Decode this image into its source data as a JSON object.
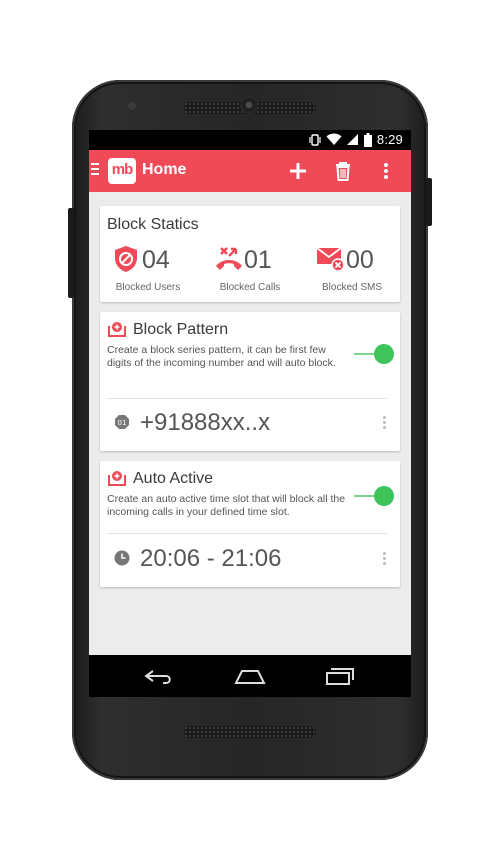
{
  "status_bar": {
    "time": "8:29",
    "icons": [
      "vibrate-icon",
      "wifi-icon",
      "signal-icon",
      "battery-icon"
    ]
  },
  "app_bar": {
    "logo_text": "mb",
    "title": "Home",
    "actions": [
      "add-icon",
      "trash-icon",
      "overflow-menu-icon"
    ]
  },
  "colors": {
    "accent": "#f04a58",
    "toggle_on": "#3ec45a",
    "background": "#ececec"
  },
  "block_statics": {
    "title": "Block Statics",
    "stats": [
      {
        "icon": "blocked-user-shield-icon",
        "count": "04",
        "label": "Blocked Users"
      },
      {
        "icon": "blocked-call-icon",
        "count": "01",
        "label": "Blocked Calls"
      },
      {
        "icon": "blocked-sms-icon",
        "count": "00",
        "label": "Blocked SMS"
      }
    ]
  },
  "block_pattern": {
    "title": "Block Pattern",
    "description": "Create a block series pattern, it can be first few digits of the incoming number and will auto block.",
    "enabled": true,
    "entry": "+91888xx..x"
  },
  "auto_active": {
    "title": "Auto Active",
    "description": "Create an auto active time slot that will block all the incoming calls in your defined time slot.",
    "enabled": true,
    "entry": "20:06 - 21:06"
  },
  "nav_bar": [
    "back-icon",
    "home-icon",
    "recent-apps-icon"
  ]
}
